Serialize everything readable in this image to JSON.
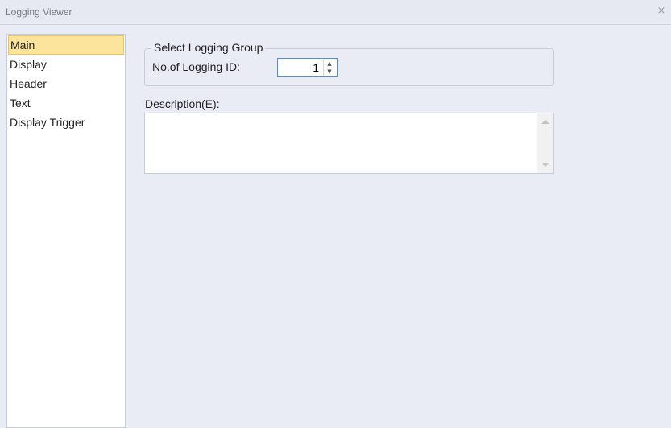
{
  "window": {
    "title": "Logging Viewer",
    "close_glyph": "×"
  },
  "sidebar": {
    "items": [
      {
        "label": "Main",
        "selected": true
      },
      {
        "label": "Display",
        "selected": false
      },
      {
        "label": "Header",
        "selected": false
      },
      {
        "label": "Text",
        "selected": false
      },
      {
        "label": "Display Trigger",
        "selected": false
      }
    ]
  },
  "logging_group": {
    "title": "Select Logging Group",
    "field_label_mnemonic": "N",
    "field_label_rest": "o.of Logging ID:",
    "value": "1",
    "spin_up_glyph": "▲",
    "spin_down_glyph": "▼"
  },
  "description": {
    "label_prefix": "Description(",
    "label_mnemonic": "E",
    "label_suffix": "):",
    "value": ""
  },
  "colors": {
    "selected_bg": "#fde49d",
    "focus_border": "#4d8fd6",
    "panel_bg": "#e9ebf5"
  }
}
